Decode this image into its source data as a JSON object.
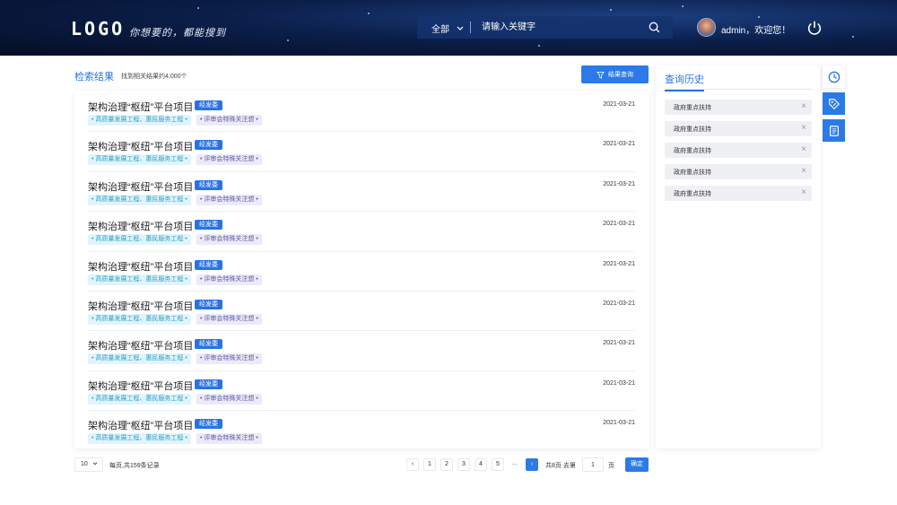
{
  "header": {
    "logo": "LOGO",
    "slogan": "你想要的，都能搜到",
    "search": {
      "scope": "全部",
      "placeholder": "请输入关键字"
    },
    "user": {
      "welcome": "admin，欢迎您！"
    }
  },
  "results": {
    "title": "检索结果",
    "count_text": "找到相关结果约4,000个",
    "filter_button": "结果查询",
    "items": [
      {
        "title": "架构治理“枢纽”平台项目",
        "badge": "经发委",
        "date": "2021-03-21",
        "tag1": "• 高质量发展工程、惠民服务工程 •",
        "tag2": "• 评审会特殊关注想 •"
      },
      {
        "title": "架构治理“枢纽”平台项目",
        "badge": "经发委",
        "date": "2021-03-21",
        "tag1": "• 高质量发展工程、惠民服务工程 •",
        "tag2": "• 评审会特殊关注想 •"
      },
      {
        "title": "架构治理“枢纽”平台项目",
        "badge": "经发委",
        "date": "2021-03-21",
        "tag1": "• 高质量发展工程、惠民服务工程 •",
        "tag2": "• 评审会特殊关注想 •"
      },
      {
        "title": "架构治理“枢纽”平台项目",
        "badge": "经发委",
        "date": "2021-03-21",
        "tag1": "• 高质量发展工程、惠民服务工程 •",
        "tag2": "• 评审会特殊关注想 •"
      },
      {
        "title": "架构治理“枢纽”平台项目",
        "badge": "经发委",
        "date": "2021-03-21",
        "tag1": "• 高质量发展工程、惠民服务工程 •",
        "tag2": "• 评审会特殊关注想 •"
      },
      {
        "title": "架构治理“枢纽”平台项目",
        "badge": "经发委",
        "date": "2021-03-21",
        "tag1": "• 高质量发展工程、惠民服务工程 •",
        "tag2": "• 评审会特殊关注想 •"
      },
      {
        "title": "架构治理“枢纽”平台项目",
        "badge": "经发委",
        "date": "2021-03-21",
        "tag1": "• 高质量发展工程、惠民服务工程 •",
        "tag2": "• 评审会特殊关注想 •"
      },
      {
        "title": "架构治理“枢纽”平台项目",
        "badge": "经发委",
        "date": "2021-03-21",
        "tag1": "• 高质量发展工程、惠民服务工程 •",
        "tag2": "• 评审会特殊关注想 •"
      },
      {
        "title": "架构治理“枢纽”平台项目",
        "badge": "经发委",
        "date": "2021-03-21",
        "tag1": "• 高质量发展工程、惠民服务工程 •",
        "tag2": "• 评审会特殊关注想 •"
      }
    ]
  },
  "pagination": {
    "page_size": "10",
    "info": "每页,共159条记录",
    "prev": "‹",
    "pages": [
      "1",
      "2",
      "3",
      "4",
      "5"
    ],
    "ellipsis": "...",
    "next": "›",
    "total_pages": "共8页 去第",
    "jump_value": "1",
    "unit": "页",
    "confirm": "确定"
  },
  "history": {
    "title": "查询历史",
    "items": [
      "政府重点扶持",
      "政府重点扶持",
      "政府重点扶持",
      "政府重点扶持",
      "政府重点扶持"
    ],
    "close_symbol": "×"
  },
  "colors": {
    "accent": "#2b7ae8",
    "header_bg": "#0b1f4a"
  },
  "icons": [
    "search-icon",
    "power-icon",
    "filter-icon",
    "clock-icon",
    "tag-icon",
    "document-icon",
    "chevron-down-icon"
  ]
}
